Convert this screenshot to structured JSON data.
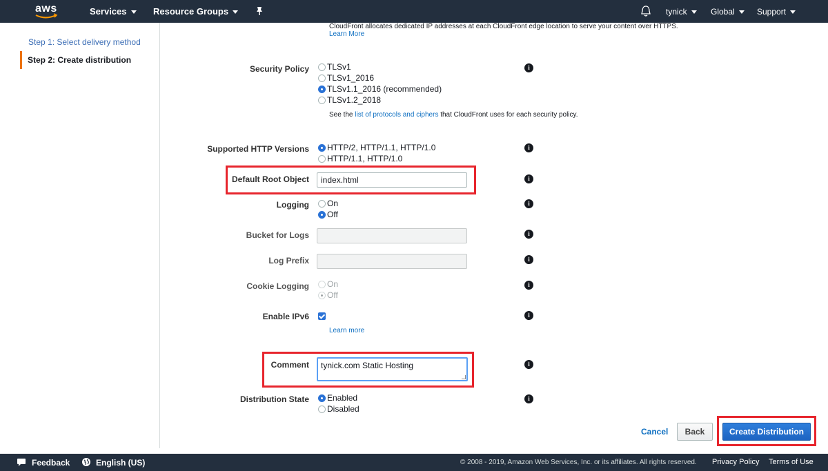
{
  "nav": {
    "logo": "aws",
    "services": "Services",
    "resource_groups": "Resource Groups",
    "user": "tynick",
    "region": "Global",
    "support": "Support"
  },
  "sidebar": {
    "step1": "Step 1: Select delivery method",
    "step2": "Step 2: Create distribution"
  },
  "form": {
    "cloudfront_note": "CloudFront allocates dedicated IP addresses at each CloudFront edge location to serve your content over HTTPS.",
    "learn_more_top": "Learn More",
    "security_policy": {
      "label": "Security Policy",
      "options": [
        "TLSv1",
        "TLSv1_2016",
        "TLSv1.1_2016 (recommended)",
        "TLSv1.2_2018"
      ],
      "selected": "TLSv1.1_2016 (recommended)",
      "note_prefix": "See the",
      "note_link": "list of protocols and ciphers",
      "note_suffix": "that CloudFront uses for each security policy."
    },
    "http_versions": {
      "label": "Supported HTTP Versions",
      "options": [
        "HTTP/2, HTTP/1.1, HTTP/1.0",
        "HTTP/1.1, HTTP/1.0"
      ],
      "selected": "HTTP/2, HTTP/1.1, HTTP/1.0"
    },
    "default_root_object": {
      "label": "Default Root Object",
      "value": "index.html"
    },
    "logging": {
      "label": "Logging",
      "options": [
        "On",
        "Off"
      ],
      "selected": "Off"
    },
    "bucket_for_logs": {
      "label": "Bucket for Logs",
      "value": ""
    },
    "log_prefix": {
      "label": "Log Prefix",
      "value": ""
    },
    "cookie_logging": {
      "label": "Cookie Logging",
      "options": [
        "On",
        "Off"
      ],
      "selected": "Off"
    },
    "enable_ipv6": {
      "label": "Enable IPv6",
      "checked": true,
      "learn_more": "Learn more"
    },
    "comment": {
      "label": "Comment",
      "value": "tynick.com Static Hosting"
    },
    "distribution_state": {
      "label": "Distribution State",
      "options": [
        "Enabled",
        "Disabled"
      ],
      "selected": "Enabled"
    }
  },
  "actions": {
    "cancel": "Cancel",
    "back": "Back",
    "create": "Create Distribution"
  },
  "footer": {
    "feedback": "Feedback",
    "language": "English (US)",
    "copyright": "© 2008 - 2019, Amazon Web Services, Inc. or its affiliates. All rights reserved.",
    "privacy": "Privacy Policy",
    "terms": "Terms of Use"
  },
  "colors": {
    "nav_bg": "#232f3e",
    "accent": "#ec7211",
    "link": "#0e6fc1",
    "primary_button": "#1c63c1",
    "highlight_box": "#e7252d"
  },
  "icons": [
    "bell-icon",
    "pin-icon",
    "info-icon",
    "speech-bubble-icon",
    "globe-icon"
  ]
}
